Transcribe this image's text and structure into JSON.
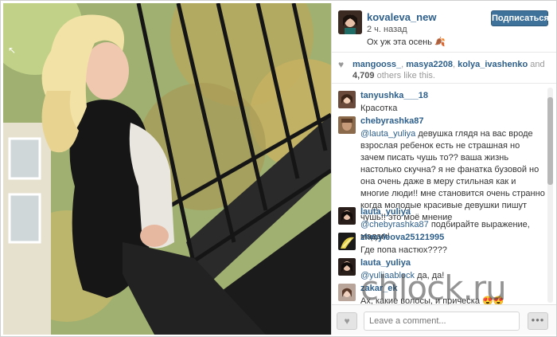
{
  "post": {
    "username": "kovaleva_new",
    "time": "2 ч. назад",
    "caption": "Ох уж эта осень 🍂",
    "follow_label": "Подписаться"
  },
  "likes": {
    "names": [
      "mangooss_",
      "masya2208",
      "kolya_ivashenko"
    ],
    "and_text": "and",
    "count": "4,709",
    "suffix": "others like this."
  },
  "comments": [
    {
      "user": "tanyushka___18",
      "parts": [
        {
          "t": "Красотка"
        }
      ]
    },
    {
      "user": "chebyrashka87",
      "parts": [
        {
          "t": "@lauta_yuliya",
          "m": true
        },
        {
          "t": " девушка глядя на вас вроде взрослая ребенок есть не страшная но зачем писать чушь то?? ваша жизнь настолько скучна? я не фанатка бузовой но она очень даже в меру стильная как и многие люди!! мне становится очень странно когда молодые красивые девушки пишут чушь!! это моё мнение"
        }
      ]
    },
    {
      "user": "lauta_yuliya",
      "parts": [
        {
          "t": "@chebyrashka87",
          "m": true
        },
        {
          "t": " подбирайте выражение, мадам!"
        }
      ]
    },
    {
      "user": "zhmyleova25121995",
      "parts": [
        {
          "t": "Где попа настюх????"
        }
      ]
    },
    {
      "user": "lauta_yuliya",
      "parts": [
        {
          "t": "@yuliiaablock",
          "m": true
        },
        {
          "t": " да, да!"
        }
      ]
    },
    {
      "user": "zakar_ek",
      "parts": [
        {
          "t": "Ах, какие волосы, и прическа 😍😍"
        }
      ]
    }
  ],
  "footer": {
    "comment_placeholder": "Leave a comment...",
    "more_label": "•••",
    "like_icon": "♥"
  },
  "watermark": "chlock.ru",
  "icons": {
    "heart": "heart-icon",
    "more": "more-options-icon"
  },
  "colors": {
    "link": "#2d5f8b",
    "follow_button": "#3f729b"
  }
}
